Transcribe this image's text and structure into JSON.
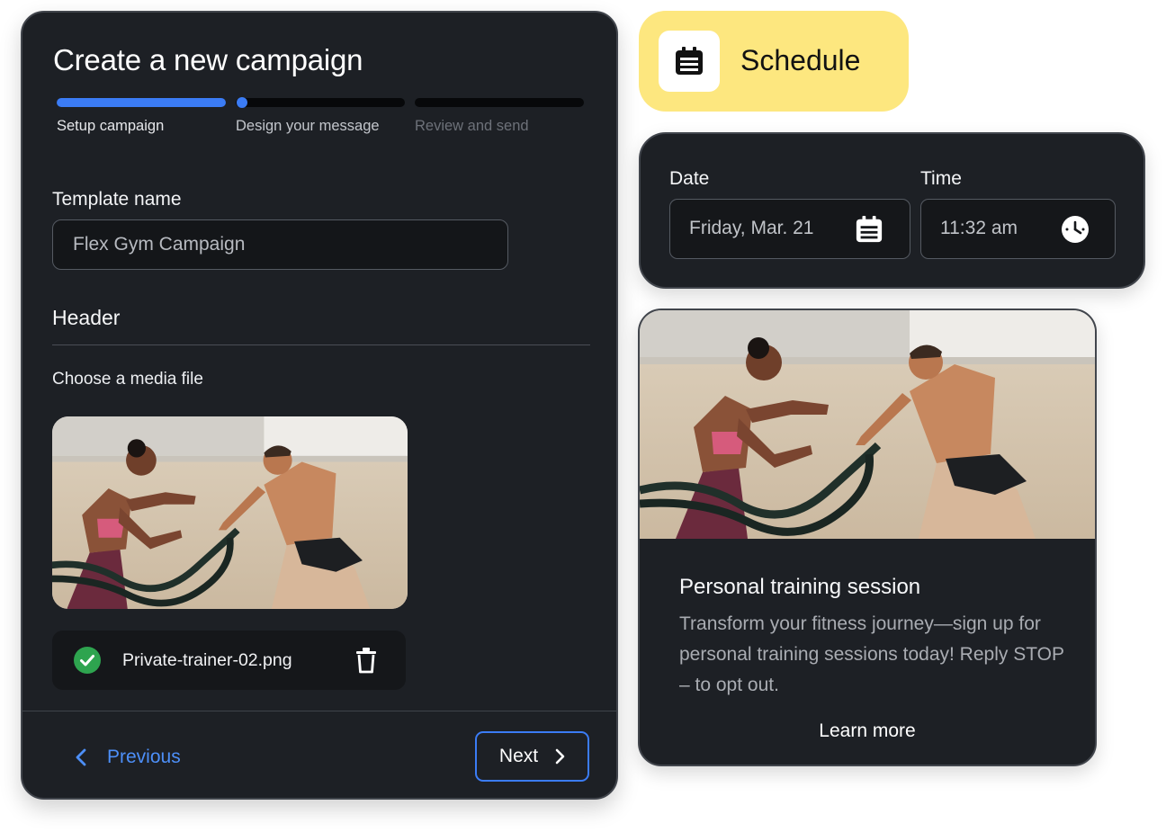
{
  "campaign": {
    "title": "Create a new campaign",
    "steps": [
      {
        "label": "Setup campaign",
        "progress": 1.0
      },
      {
        "label": "Design your message",
        "progress": 0.05
      },
      {
        "label": "Review and send",
        "progress": 0
      }
    ],
    "template_name_label": "Template name",
    "template_name_value": "Flex Gym Campaign",
    "header_section_title": "Header",
    "media_label": "Choose a media file",
    "file_name": "Private-trainer-02.png",
    "previous_label": "Previous",
    "next_label": "Next"
  },
  "schedule": {
    "title": "Schedule",
    "icon": "calendar-icon",
    "date_label": "Date",
    "date_value": "Friday, Mar. 21",
    "time_label": "Time",
    "time_value": "11:32 am"
  },
  "preview": {
    "title": "Personal training session",
    "body": "Transform your fitness journey—sign up for personal training sessions today! Reply STOP – to opt out.",
    "link_label": "Learn more"
  },
  "colors": {
    "accent": "#3b7cf5",
    "card_bg": "#1d2025",
    "schedule_bg": "#fde77f",
    "success": "#2ea44f"
  }
}
